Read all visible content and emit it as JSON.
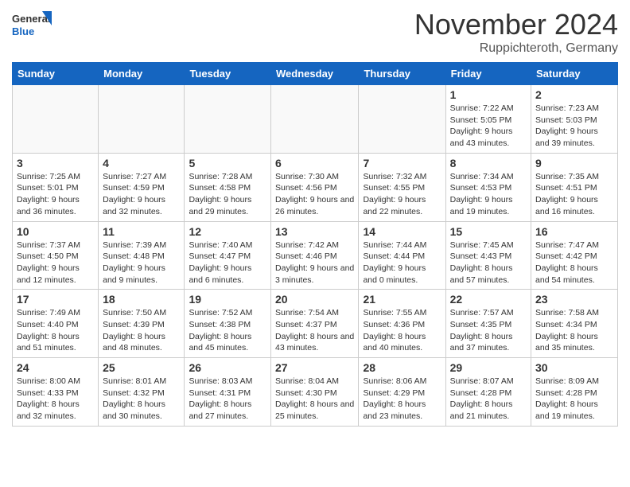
{
  "logo": {
    "general": "General",
    "blue": "Blue"
  },
  "header": {
    "month": "November 2024",
    "location": "Ruppichteroth, Germany"
  },
  "weekdays": [
    "Sunday",
    "Monday",
    "Tuesday",
    "Wednesday",
    "Thursday",
    "Friday",
    "Saturday"
  ],
  "weeks": [
    [
      {
        "day": "",
        "info": ""
      },
      {
        "day": "",
        "info": ""
      },
      {
        "day": "",
        "info": ""
      },
      {
        "day": "",
        "info": ""
      },
      {
        "day": "",
        "info": ""
      },
      {
        "day": "1",
        "info": "Sunrise: 7:22 AM\nSunset: 5:05 PM\nDaylight: 9 hours and 43 minutes."
      },
      {
        "day": "2",
        "info": "Sunrise: 7:23 AM\nSunset: 5:03 PM\nDaylight: 9 hours and 39 minutes."
      }
    ],
    [
      {
        "day": "3",
        "info": "Sunrise: 7:25 AM\nSunset: 5:01 PM\nDaylight: 9 hours and 36 minutes."
      },
      {
        "day": "4",
        "info": "Sunrise: 7:27 AM\nSunset: 4:59 PM\nDaylight: 9 hours and 32 minutes."
      },
      {
        "day": "5",
        "info": "Sunrise: 7:28 AM\nSunset: 4:58 PM\nDaylight: 9 hours and 29 minutes."
      },
      {
        "day": "6",
        "info": "Sunrise: 7:30 AM\nSunset: 4:56 PM\nDaylight: 9 hours and 26 minutes."
      },
      {
        "day": "7",
        "info": "Sunrise: 7:32 AM\nSunset: 4:55 PM\nDaylight: 9 hours and 22 minutes."
      },
      {
        "day": "8",
        "info": "Sunrise: 7:34 AM\nSunset: 4:53 PM\nDaylight: 9 hours and 19 minutes."
      },
      {
        "day": "9",
        "info": "Sunrise: 7:35 AM\nSunset: 4:51 PM\nDaylight: 9 hours and 16 minutes."
      }
    ],
    [
      {
        "day": "10",
        "info": "Sunrise: 7:37 AM\nSunset: 4:50 PM\nDaylight: 9 hours and 12 minutes."
      },
      {
        "day": "11",
        "info": "Sunrise: 7:39 AM\nSunset: 4:48 PM\nDaylight: 9 hours and 9 minutes."
      },
      {
        "day": "12",
        "info": "Sunrise: 7:40 AM\nSunset: 4:47 PM\nDaylight: 9 hours and 6 minutes."
      },
      {
        "day": "13",
        "info": "Sunrise: 7:42 AM\nSunset: 4:46 PM\nDaylight: 9 hours and 3 minutes."
      },
      {
        "day": "14",
        "info": "Sunrise: 7:44 AM\nSunset: 4:44 PM\nDaylight: 9 hours and 0 minutes."
      },
      {
        "day": "15",
        "info": "Sunrise: 7:45 AM\nSunset: 4:43 PM\nDaylight: 8 hours and 57 minutes."
      },
      {
        "day": "16",
        "info": "Sunrise: 7:47 AM\nSunset: 4:42 PM\nDaylight: 8 hours and 54 minutes."
      }
    ],
    [
      {
        "day": "17",
        "info": "Sunrise: 7:49 AM\nSunset: 4:40 PM\nDaylight: 8 hours and 51 minutes."
      },
      {
        "day": "18",
        "info": "Sunrise: 7:50 AM\nSunset: 4:39 PM\nDaylight: 8 hours and 48 minutes."
      },
      {
        "day": "19",
        "info": "Sunrise: 7:52 AM\nSunset: 4:38 PM\nDaylight: 8 hours and 45 minutes."
      },
      {
        "day": "20",
        "info": "Sunrise: 7:54 AM\nSunset: 4:37 PM\nDaylight: 8 hours and 43 minutes."
      },
      {
        "day": "21",
        "info": "Sunrise: 7:55 AM\nSunset: 4:36 PM\nDaylight: 8 hours and 40 minutes."
      },
      {
        "day": "22",
        "info": "Sunrise: 7:57 AM\nSunset: 4:35 PM\nDaylight: 8 hours and 37 minutes."
      },
      {
        "day": "23",
        "info": "Sunrise: 7:58 AM\nSunset: 4:34 PM\nDaylight: 8 hours and 35 minutes."
      }
    ],
    [
      {
        "day": "24",
        "info": "Sunrise: 8:00 AM\nSunset: 4:33 PM\nDaylight: 8 hours and 32 minutes."
      },
      {
        "day": "25",
        "info": "Sunrise: 8:01 AM\nSunset: 4:32 PM\nDaylight: 8 hours and 30 minutes."
      },
      {
        "day": "26",
        "info": "Sunrise: 8:03 AM\nSunset: 4:31 PM\nDaylight: 8 hours and 27 minutes."
      },
      {
        "day": "27",
        "info": "Sunrise: 8:04 AM\nSunset: 4:30 PM\nDaylight: 8 hours and 25 minutes."
      },
      {
        "day": "28",
        "info": "Sunrise: 8:06 AM\nSunset: 4:29 PM\nDaylight: 8 hours and 23 minutes."
      },
      {
        "day": "29",
        "info": "Sunrise: 8:07 AM\nSunset: 4:28 PM\nDaylight: 8 hours and 21 minutes."
      },
      {
        "day": "30",
        "info": "Sunrise: 8:09 AM\nSunset: 4:28 PM\nDaylight: 8 hours and 19 minutes."
      }
    ]
  ]
}
